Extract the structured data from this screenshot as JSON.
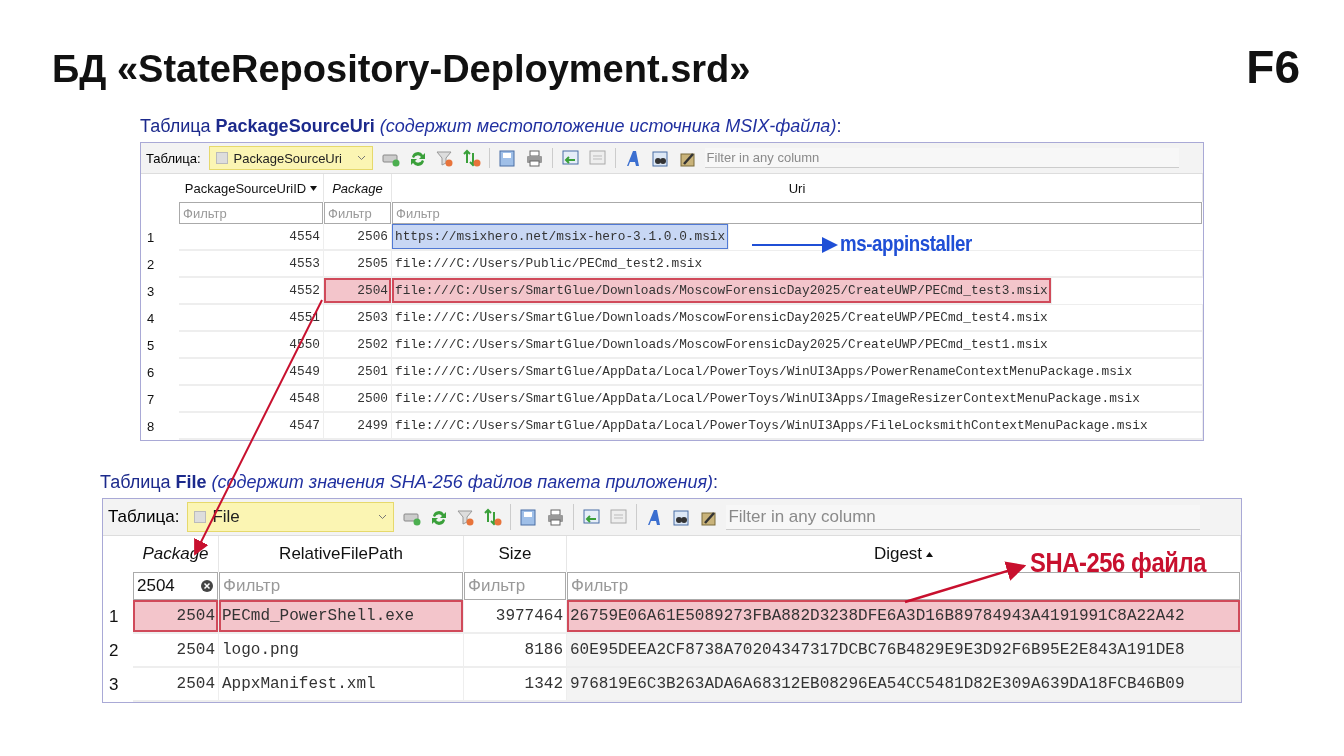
{
  "title": "БД «StateRepository-Deployment.srd»",
  "badge": "F6",
  "sections": [
    {
      "caption": "Таблица **PackageSourceUri** *(содержит местоположение источника MSIX-файла)*:",
      "kind": "compact",
      "toolbar": {
        "label": "Таблица:",
        "table": "PackageSourceUri",
        "search_placeholder": "Filter in any column"
      },
      "columns": [
        {
          "label": "PackageSourceUriID",
          "italic": false,
          "sorted_ascending": false,
          "sorted_descending": true
        },
        {
          "label": "Package",
          "italic": true,
          "sorted_ascending": false,
          "sorted_descending": false
        },
        {
          "label": "Uri",
          "italic": false,
          "sorted_ascending": false,
          "sorted_descending": false
        }
      ],
      "filters": [
        {
          "placeholder": "Фильтр"
        },
        {
          "placeholder": "Фильтр"
        },
        {
          "placeholder": "Фильтр"
        }
      ],
      "rows": [
        {
          "number": "1",
          "cells": [
            {
              "text": "4554"
            },
            {
              "text": "2506"
            },
            {
              "text": "https://msixhero.net/msix-hero-3.1.0.0.msix",
              "selected": true
            }
          ]
        },
        {
          "number": "2",
          "cells": [
            {
              "text": "4553"
            },
            {
              "text": "2505"
            },
            {
              "text": "file:///C:/Users/Public/PECmd_test2.msix"
            }
          ]
        },
        {
          "number": "3",
          "cells": [
            {
              "text": "4552"
            },
            {
              "text": "2504",
              "marked": true
            },
            {
              "text": "file:///C:/Users/SmartGlue/Downloads/MoscowForensicDay2025/CreateUWP/PECmd_test3.msix",
              "marked": true
            }
          ]
        },
        {
          "number": "4",
          "cells": [
            {
              "text": "4551"
            },
            {
              "text": "2503"
            },
            {
              "text": "file:///C:/Users/SmartGlue/Downloads/MoscowForensicDay2025/CreateUWP/PECmd_test4.msix"
            }
          ]
        },
        {
          "number": "5",
          "cells": [
            {
              "text": "4550"
            },
            {
              "text": "2502"
            },
            {
              "text": "file:///C:/Users/SmartGlue/Downloads/MoscowForensicDay2025/CreateUWP/PECmd_test1.msix"
            }
          ]
        },
        {
          "number": "6",
          "cells": [
            {
              "text": "4549"
            },
            {
              "text": "2501"
            },
            {
              "text": "file:///C:/Users/SmartGlue/AppData/Local/PowerToys/WinUI3Apps/PowerRenameContextMenuPackage.msix"
            }
          ]
        },
        {
          "number": "7",
          "cells": [
            {
              "text": "4548"
            },
            {
              "text": "2500"
            },
            {
              "text": "file:///C:/Users/SmartGlue/AppData/Local/PowerToys/WinUI3Apps/ImageResizerContextMenuPackage.msix"
            }
          ]
        },
        {
          "number": "8",
          "cells": [
            {
              "text": "4547"
            },
            {
              "text": "2499"
            },
            {
              "text": "file:///C:/Users/SmartGlue/AppData/Local/PowerToys/WinUI3Apps/FileLocksmithContextMenuPackage.msix"
            }
          ]
        }
      ]
    },
    {
      "caption": "Таблица **File** *(содержит значения SHA-256 файлов пакета приложения)*:",
      "kind": "wide",
      "toolbar": {
        "label": "Таблица:",
        "table": "File",
        "search_placeholder": "Filter in any column"
      },
      "columns": [
        {
          "label": "Package",
          "italic": true,
          "sorted_ascending": false,
          "sorted_descending": false
        },
        {
          "label": "RelativeFilePath",
          "italic": false,
          "sorted_ascending": false,
          "sorted_descending": false
        },
        {
          "label": "Size",
          "italic": false,
          "sorted_ascending": false,
          "sorted_descending": false
        },
        {
          "label": "Digest",
          "italic": false,
          "sorted_ascending": true,
          "sorted_descending": false
        }
      ],
      "filters": [
        {
          "value": "2504"
        },
        {
          "placeholder": "Фильтр"
        },
        {
          "placeholder": "Фильтр"
        },
        {
          "placeholder": "Фильтр"
        }
      ],
      "rows": [
        {
          "number": "1",
          "cells": [
            {
              "text": "2504",
              "marked": true
            },
            {
              "text": "PECmd_PowerShell.exe",
              "marked": true
            },
            {
              "text": "3977464"
            },
            {
              "text": "26759E06A61E5089273FBA882D3238DFE6A3D16B89784943A4191991C8A22A42",
              "marked": true
            }
          ]
        },
        {
          "number": "2",
          "cells": [
            {
              "text": "2504"
            },
            {
              "text": "logo.png"
            },
            {
              "text": "8186"
            },
            {
              "text": "60E95DEEA2CF8738A70204347317DCBC76B4829E9E3D92F6B95E2E843A191DE8"
            }
          ]
        },
        {
          "number": "3",
          "cells": [
            {
              "text": "2504"
            },
            {
              "text": "AppxManifest.xml"
            },
            {
              "text": "1342"
            },
            {
              "text": "976819E6C3B263ADA6A68312EB08296EA54CC5481D82E309A639DA18FCB46B09"
            }
          ]
        }
      ]
    }
  ],
  "annotations": [
    {
      "text": "ms-appinstaller",
      "color": "#1f4fd6"
    },
    {
      "text": "SHA-256 файла",
      "color": "#c8102e"
    }
  ]
}
